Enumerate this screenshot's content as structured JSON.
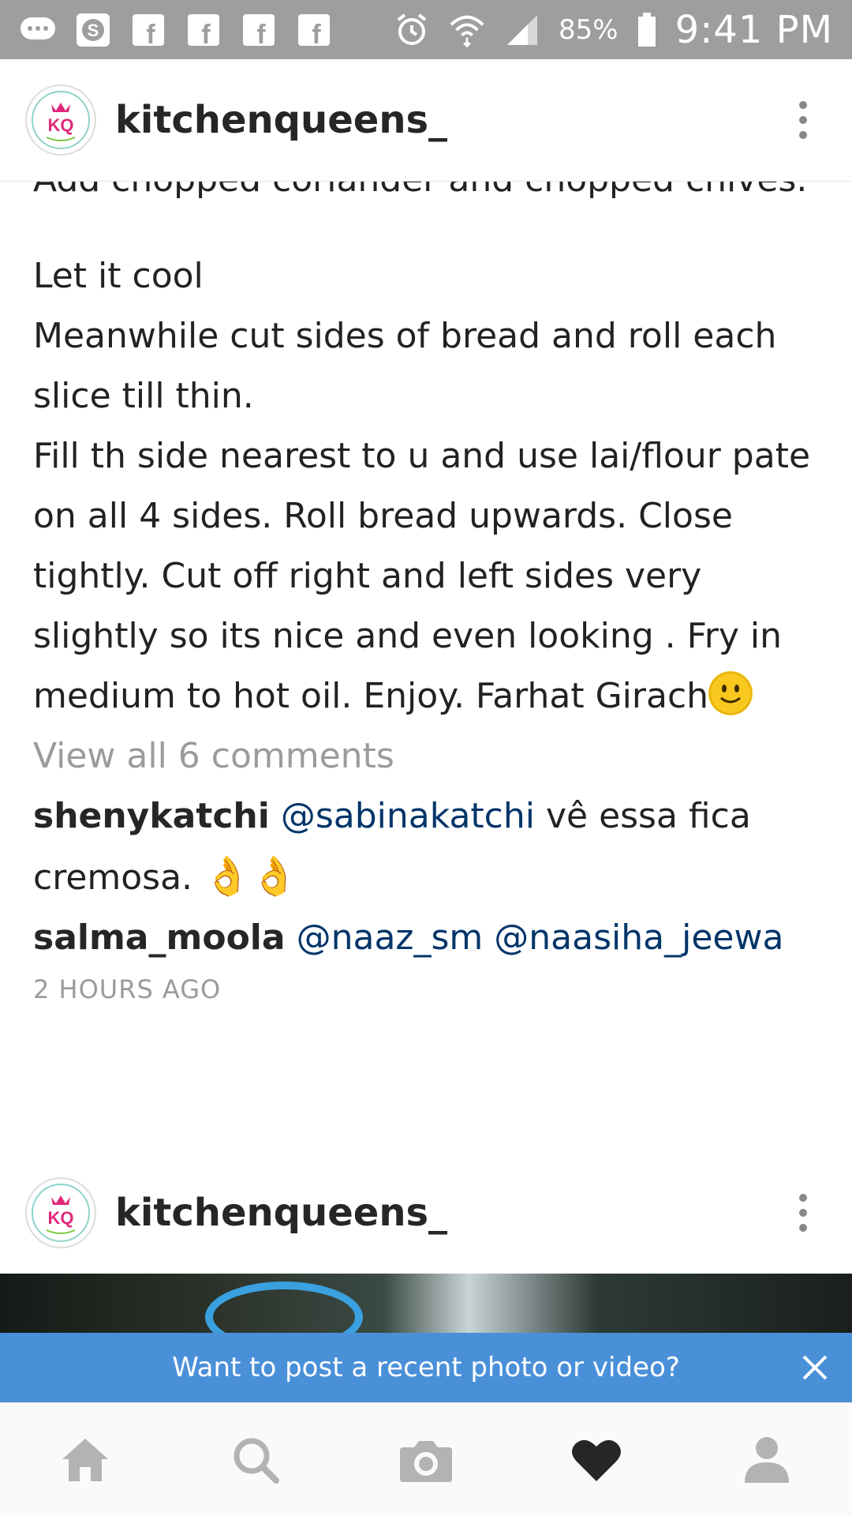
{
  "status_bar": {
    "battery_percent": "85%",
    "time": "9:41 PM",
    "icons": [
      "messages-icon",
      "skype-icon",
      "facebook-icon",
      "facebook-icon",
      "facebook-icon",
      "facebook-icon",
      "alarm-icon",
      "wifi-icon",
      "signal-icon",
      "battery-icon"
    ]
  },
  "post1": {
    "username": "kitchenqueens_",
    "avatar_text": "KQ",
    "caption_partial_top": "Add chopped coriander and chopped chives.",
    "caption_lines": [
      "Let it cool",
      "Meanwhile cut sides of bread and roll each slice till thin.",
      "Fill th side nearest to u and use lai/flour pate on all 4 sides. Roll bread upwards. Close tightly. Cut off right and left sides very slightly so its nice and even looking . Fry in medium to hot oil. Enjoy. Farhat Girach"
    ],
    "view_all_comments": "View all 6 comments",
    "comments": [
      {
        "user": "shenykatchi",
        "mention": "@sabinakatchi",
        "text": "vê essa fica cremosa.",
        "emoji": "👌👌"
      },
      {
        "user": "salma_moola",
        "mention1": "@naaz_sm",
        "mention2": "@naasiha_jeewa"
      }
    ],
    "timestamp": "2 HOURS AGO"
  },
  "post2": {
    "username": "kitchenqueens_",
    "avatar_text": "KQ"
  },
  "banner": {
    "text": "Want to post a recent photo or video?"
  },
  "bottom_nav": [
    "home-icon",
    "search-icon",
    "camera-icon",
    "heart-icon",
    "profile-icon"
  ],
  "colors": {
    "status_bar": "#9e9e9e",
    "banner": "#4a90d9",
    "mention": "#003569",
    "muted": "#9b9b9b"
  }
}
